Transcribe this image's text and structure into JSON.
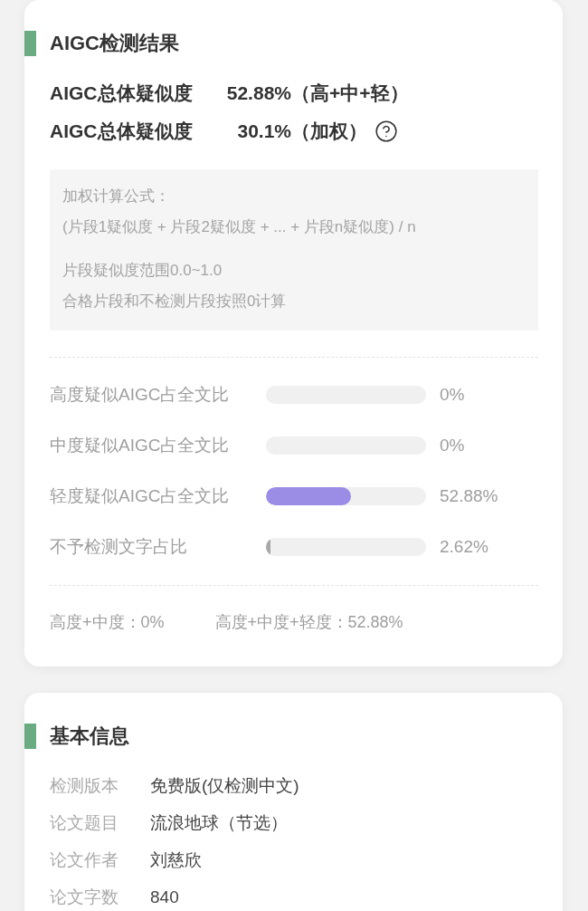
{
  "result_card": {
    "title": "AIGC检测结果",
    "summary": [
      {
        "label": "AIGC总体疑似度",
        "value": "52.88%",
        "qualifier": "（高+中+轻）",
        "help": false
      },
      {
        "label": "AIGC总体疑似度",
        "value": "30.1%",
        "qualifier": "（加权）",
        "help": true
      }
    ],
    "formula_note": {
      "title": "加权计算公式：",
      "formula": "(片段1疑似度 + 片段2疑似度 + ... + 片段n疑似度) / n",
      "notes": [
        "片段疑似度范围0.0~1.0",
        "合格片段和不检测片段按照0计算"
      ]
    },
    "ratios": [
      {
        "label": "高度疑似AIGC占全文比",
        "level": 0,
        "value": "0%"
      },
      {
        "label": "中度疑似AIGC占全文比",
        "level": 0,
        "value": "0%"
      },
      {
        "label": "轻度疑似AIGC占全文比",
        "level": 0.5288,
        "value": "52.88%",
        "color": "#9b8ce6"
      },
      {
        "label": "不予检测文字占比",
        "level": 0.0262,
        "value": "2.62%",
        "color": "#a8a8a8"
      }
    ],
    "totals": [
      "高度+中度：0%",
      "高度+中度+轻度：52.88%"
    ]
  },
  "info_card": {
    "title": "基本信息",
    "rows": [
      {
        "label": "检测版本",
        "value": "免费版(仅检测中文)"
      },
      {
        "label": "论文题目",
        "value": "流浪地球（节选）"
      },
      {
        "label": "论文作者",
        "value": "刘慈欣"
      },
      {
        "label": "论文字数",
        "value": "840"
      }
    ]
  }
}
